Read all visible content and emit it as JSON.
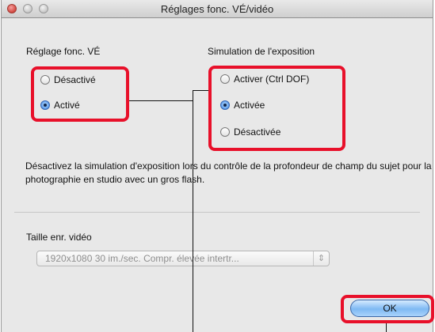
{
  "window": {
    "title": "Réglages fonc. VÉ/vidéo"
  },
  "live_view": {
    "heading": "Réglage fonc. VÉ",
    "options": [
      {
        "label": "Désactivé",
        "checked": false
      },
      {
        "label": "Activé",
        "checked": true
      }
    ]
  },
  "exposure_simulation": {
    "heading": "Simulation de l'exposition",
    "options": [
      {
        "label": "Activer (Ctrl DOF)",
        "checked": false
      },
      {
        "label": "Activée",
        "checked": true
      },
      {
        "label": "Désactivée",
        "checked": false
      }
    ]
  },
  "description": "Désactivez la simulation d'exposition lors du contrôle de la profondeur de champ du sujet pour la photographie en studio avec un gros flash.",
  "movie_size": {
    "label": "Taille enr. vidéo",
    "selected": "1920x1080 30 im./sec. Compr. élevée intertr...",
    "arrow_icon": "up-down-arrows-icon"
  },
  "ok_button": {
    "label": "OK"
  },
  "colors": {
    "highlight": "#e8102a",
    "radio_selected": "#5b9bea",
    "button": "#7eb9f3"
  }
}
